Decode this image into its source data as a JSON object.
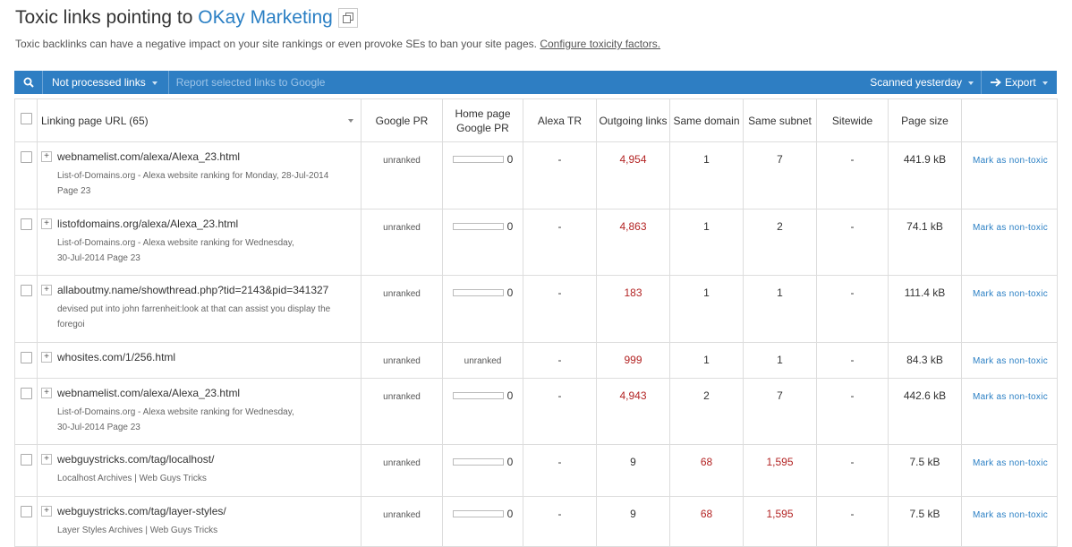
{
  "header": {
    "title_prefix": "Toxic links pointing to ",
    "site_name": "OKay Marketing",
    "subtitle": "Toxic backlinks can have a negative impact on your site rankings or even provoke SEs to ban your site pages.",
    "configure_link": "Configure toxicity factors."
  },
  "toolbar": {
    "filter_label": "Not processed links",
    "report_label": "Report selected links to Google",
    "scanned_label": "Scanned yesterday",
    "export_label": "Export"
  },
  "columns": {
    "url": "Linking page URL (65)",
    "google_pr": "Google PR",
    "home_pr": "Home page Google PR",
    "alexa": "Alexa TR",
    "outgoing": "Outgoing links",
    "same_domain": "Same domain",
    "same_subnet": "Same subnet",
    "sitewide": "Sitewide",
    "page_size": "Page size"
  },
  "rows": [
    {
      "url": "webnamelist.com/alexa/Alexa_23.html",
      "desc1": "List-of-Domains.org - Alexa website ranking for Monday, 28-Jul-2014",
      "desc2": "Page 23",
      "google_pr": "unranked",
      "home_pr": "0",
      "alexa": "-",
      "outgoing": "4,954",
      "same_domain": "1",
      "same_subnet": "7",
      "sitewide": "-",
      "page_size": "441.9 kB",
      "action": "Mark as non-toxic"
    },
    {
      "url": "listofdomains.org/alexa/Alexa_23.html",
      "desc1": "List-of-Domains.org - Alexa website ranking for Wednesday,",
      "desc2": "30-Jul-2014 Page 23",
      "google_pr": "unranked",
      "home_pr": "0",
      "alexa": "-",
      "outgoing": "4,863",
      "same_domain": "1",
      "same_subnet": "2",
      "sitewide": "-",
      "page_size": "74.1 kB",
      "action": "Mark as non-toxic"
    },
    {
      "url": "allaboutmy.name/showthread.php?tid=2143&pid=341327",
      "desc1": "devised put into john farrenheit:look at that can assist you display the",
      "desc2": "foregoi",
      "google_pr": "unranked",
      "home_pr": "0",
      "alexa": "-",
      "outgoing": "183",
      "same_domain": "1",
      "same_subnet": "1",
      "sitewide": "-",
      "page_size": "111.4 kB",
      "action": "Mark as non-toxic"
    },
    {
      "url": "whosites.com/1/256.html",
      "google_pr": "unranked",
      "home_pr_text": "unranked",
      "alexa": "-",
      "outgoing": "999",
      "same_domain": "1",
      "same_subnet": "1",
      "sitewide": "-",
      "page_size": "84.3 kB",
      "action": "Mark as non-toxic"
    },
    {
      "url": "webnamelist.com/alexa/Alexa_23.html",
      "desc1": "List-of-Domains.org - Alexa website ranking for Wednesday,",
      "desc2": "30-Jul-2014 Page 23",
      "google_pr": "unranked",
      "home_pr": "0",
      "alexa": "-",
      "outgoing": "4,943",
      "same_domain": "2",
      "same_subnet": "7",
      "sitewide": "-",
      "page_size": "442.6 kB",
      "action": "Mark as non-toxic"
    },
    {
      "url": "webguystricks.com/tag/localhost/",
      "desc1": "Localhost Archives | Web Guys Tricks",
      "google_pr": "unranked",
      "home_pr": "0",
      "alexa": "-",
      "outgoing": "9",
      "same_domain": "68",
      "same_subnet": "1,595",
      "sitewide": "-",
      "page_size": "7.5 kB",
      "action": "Mark as non-toxic"
    },
    {
      "url": "webguystricks.com/tag/layer-styles/",
      "desc1": "Layer Styles Archives | Web Guys Tricks",
      "google_pr": "unranked",
      "home_pr": "0",
      "alexa": "-",
      "outgoing": "9",
      "same_domain": "68",
      "same_subnet": "1,595",
      "sitewide": "-",
      "page_size": "7.5 kB",
      "action": "Mark as non-toxic"
    }
  ],
  "colors": {
    "accent": "#2e7ec3",
    "link": "#2a7fc4",
    "toxic_red": "#b32424"
  }
}
